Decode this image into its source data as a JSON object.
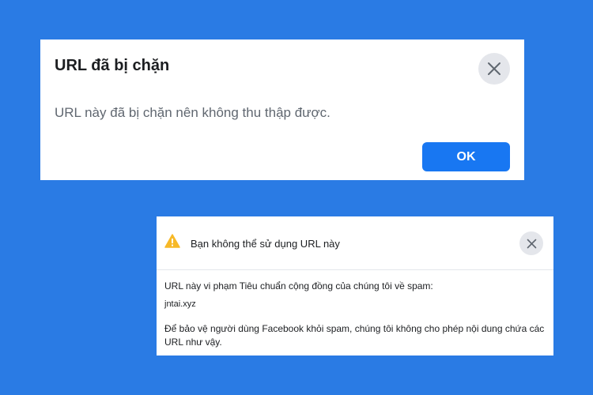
{
  "dialog_blocked": {
    "title": "URL đã bị chặn",
    "message": "URL này đã bị chặn nên không thu thập được.",
    "ok_label": "OK",
    "close_icon": "close-icon"
  },
  "dialog_spam": {
    "title": "Bạn không thể sử dụng URL này",
    "warning_icon": "warning-icon",
    "close_icon": "close-icon",
    "violation_text": "URL này vi phạm Tiêu chuẩn cộng đồng của chúng tôi về spam:",
    "domain": "jntai.xyz",
    "explanation": "Để bảo vệ người dùng Facebook khỏi spam, chúng tôi không cho phép nội dung chứa các URL như vậy."
  },
  "colors": {
    "background": "#2a7be4",
    "primary_button": "#1877f2",
    "warning": "#f7b928"
  }
}
